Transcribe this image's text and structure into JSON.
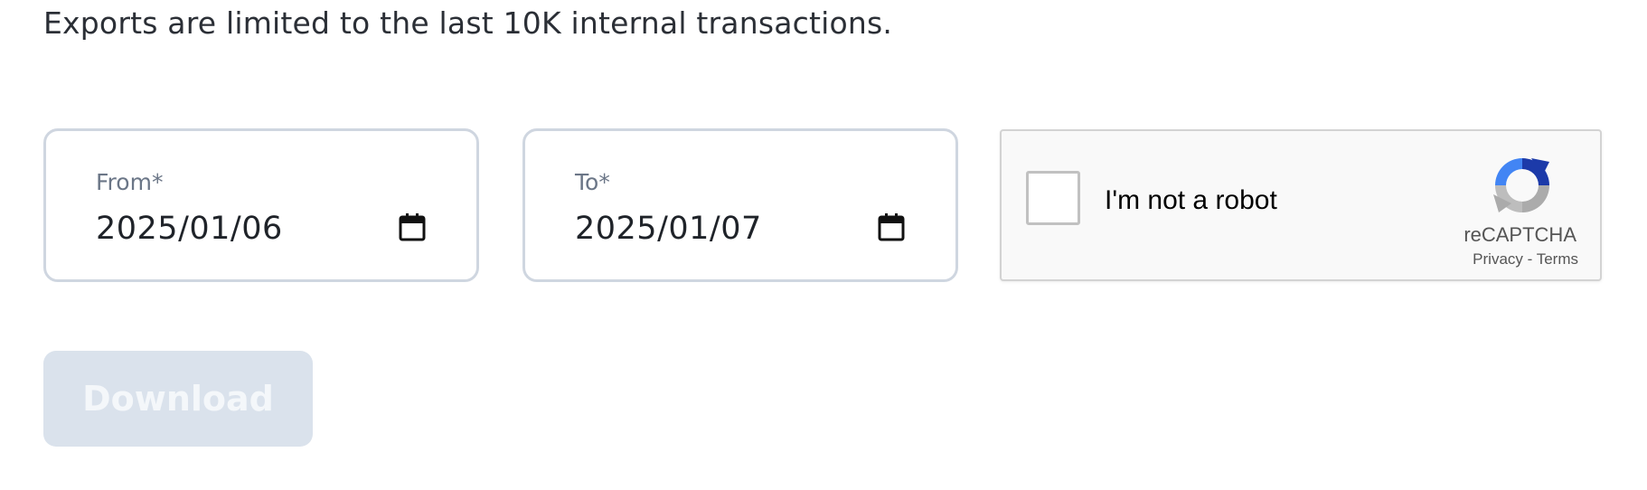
{
  "notice": "Exports are limited to the last 10K internal transactions.",
  "from_field": {
    "label": "From*",
    "value": "2025/01/06",
    "icon": "calendar-icon"
  },
  "to_field": {
    "label": "To*",
    "value": "2025/01/07",
    "icon": "calendar-icon"
  },
  "recaptcha": {
    "label": "I'm not a robot",
    "checked": false,
    "brand": "reCAPTCHA",
    "privacy": "Privacy",
    "separator": " - ",
    "terms": "Terms",
    "icon": "recaptcha-logo-icon"
  },
  "download_button": {
    "label": "Download",
    "disabled": true
  },
  "colors": {
    "field_border": "#cfd6e0",
    "button_disabled_bg": "#dae2ec",
    "label_gray": "#6b7687"
  }
}
